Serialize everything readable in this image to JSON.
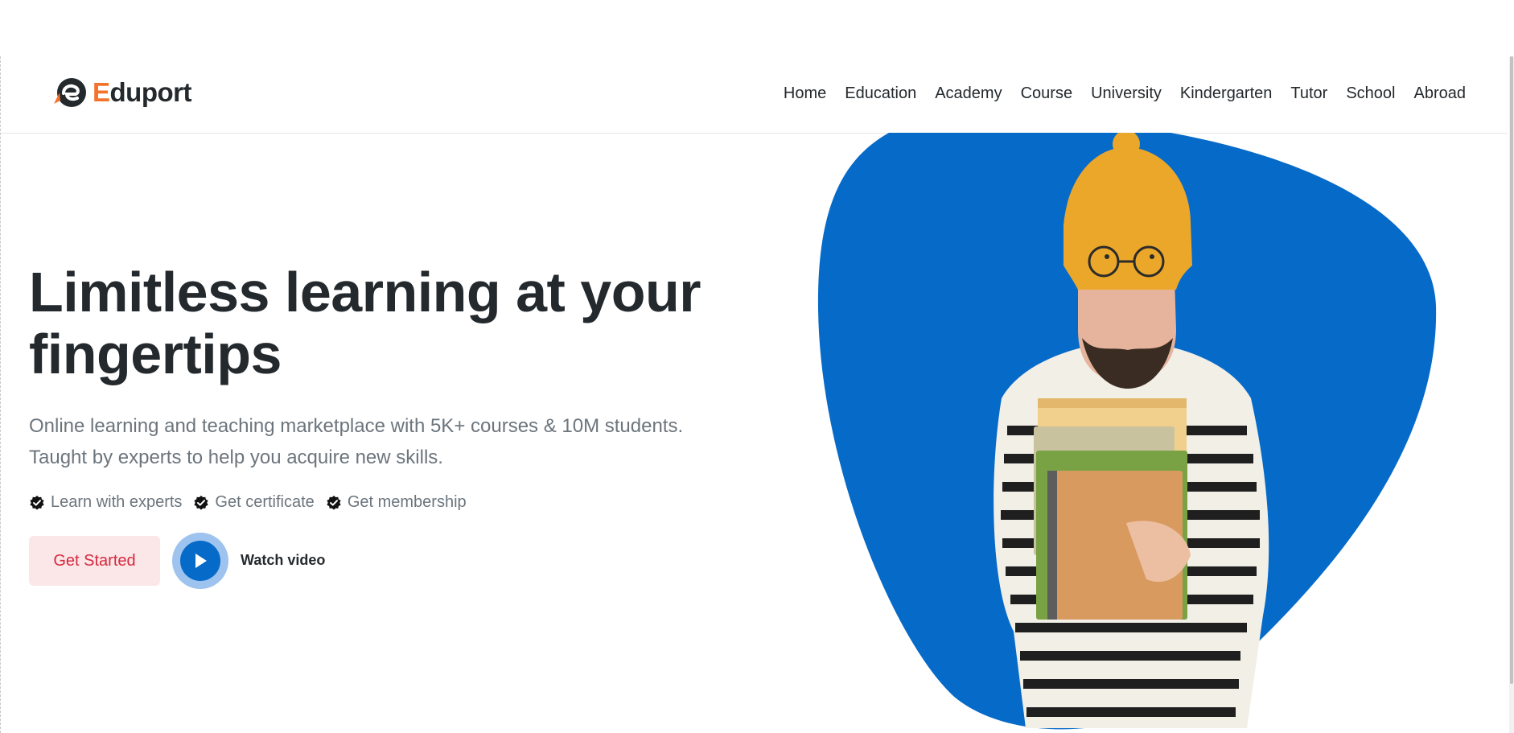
{
  "brand": {
    "name_first": "E",
    "name_rest": "duport",
    "logo_icon": "eduport-e-icon",
    "accent_color": "#f3722c"
  },
  "nav": {
    "items": [
      "Home",
      "Education",
      "Academy",
      "Course",
      "University",
      "Kindergarten",
      "Tutor",
      "School",
      "Abroad"
    ]
  },
  "hero": {
    "headline_line1": "Limitless learning at your",
    "headline_line2": "fingertips",
    "subtext_line1": "Online learning and teaching marketplace with 5K+ courses & 10M students.",
    "subtext_line2": "Taught by experts to help you acquire new skills.",
    "features": [
      "Learn with experts",
      "Get certificate",
      "Get membership"
    ],
    "feature_icon": "verified-badge-icon",
    "primary_button": "Get Started",
    "video_label": "Watch video",
    "image_subject": "Man in yellow beanie and striped sweater holding books",
    "image_blob_color": "#066ac9"
  },
  "colors": {
    "heading": "#24292d",
    "muted": "#6c757d",
    "primary": "#066ac9",
    "danger": "#d6293e",
    "danger_soft": "#fbe6e8",
    "highlight": "#fde3c4"
  }
}
